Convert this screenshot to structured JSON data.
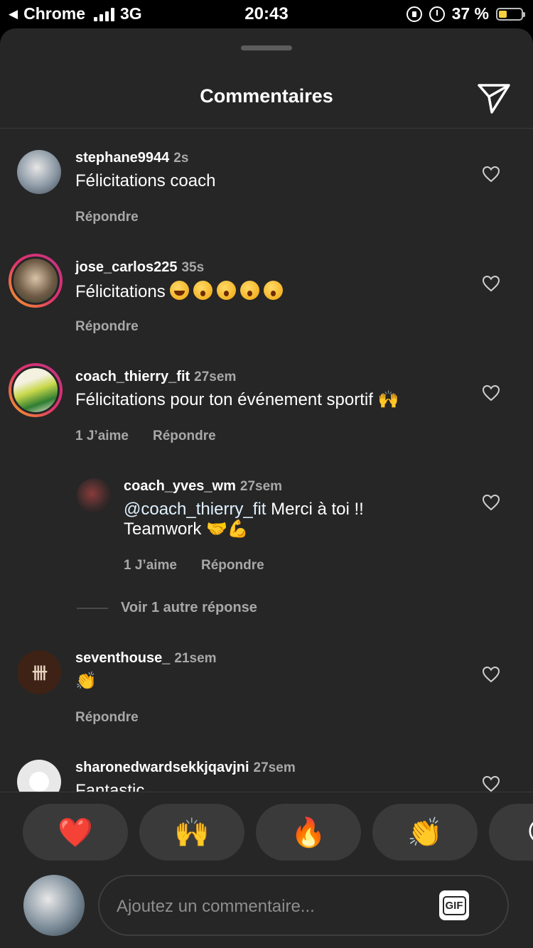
{
  "status_bar": {
    "back_app": "Chrome",
    "network": "3G",
    "time": "20:43",
    "battery": "37 %",
    "battery_level": 0.37
  },
  "header": {
    "title": "Commentaires"
  },
  "comments": [
    {
      "user": "stephane9944",
      "time": "2s",
      "text": "Félicitations coach",
      "likes": "",
      "reply": "Répondre"
    },
    {
      "user": "jose_carlos225",
      "time": "35s",
      "text": "Félicitations",
      "emoji": [
        "laugh-emoji",
        "wow-emoji",
        "wow-emoji",
        "wow-emoji",
        "wow-emoji"
      ],
      "likes": "",
      "reply": "Répondre"
    },
    {
      "user": "coach_thierry_fit",
      "time": "27sem",
      "text": "Félicitations pour ton événement sportif 🙌",
      "likes": "1 J’aime",
      "reply": "Répondre"
    },
    {
      "user": "coach_yves_wm",
      "time": "27sem",
      "mention": "@coach_thierry_fit",
      "text": " Merci à toi !! Teamwork 🤝💪",
      "likes": "1 J’aime",
      "reply": "Répondre"
    },
    {
      "user": "seventhouse_",
      "time": "21sem",
      "text": "👏",
      "likes": "",
      "reply": "Répondre"
    },
    {
      "user": "sharonedwardsekkjqavjni",
      "time": "27sem",
      "text": "Fantastic",
      "likes": "",
      "reply": ""
    }
  ],
  "view_more_replies": "Voir 1 autre réponse",
  "reactions": [
    "❤️",
    "🙌",
    "🔥",
    "👏",
    "😢"
  ],
  "composer": {
    "placeholder": "Ajoutez un commentaire...",
    "gif_label": "GIF"
  },
  "colors": {
    "sheet_bg": "#262626",
    "secondary_text": "#a8a8a8",
    "mention": "#e0f1ff"
  }
}
